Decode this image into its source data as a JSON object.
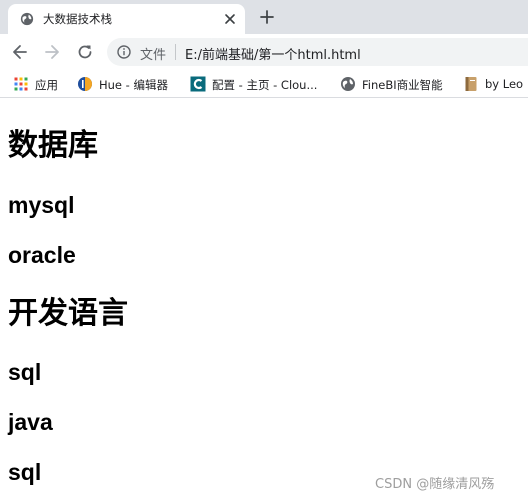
{
  "tab": {
    "title": "大数据技术栈"
  },
  "omnibox": {
    "scheme_label": "文件",
    "url": "E:/前端基础/第一个html.html"
  },
  "bookmarks": [
    {
      "label": "应用",
      "icon": "apps-grid-icon"
    },
    {
      "label": "Hue - 编辑器",
      "icon": "hue-icon"
    },
    {
      "label": "配置 - 主页 - Clou...",
      "icon": "cloudera-icon"
    },
    {
      "label": "FineBI商业智能",
      "icon": "globe-icon"
    },
    {
      "label": "by Leo",
      "icon": "notebook-icon"
    }
  ],
  "content": {
    "heading_database": "数据库",
    "item_mysql": "mysql",
    "item_oracle": "oracle",
    "heading_dev_lang": "开发语言",
    "item_sql_1": "sql",
    "item_java": "java",
    "item_sql_2": "sql"
  },
  "watermark": "CSDN @随缘清风殇"
}
